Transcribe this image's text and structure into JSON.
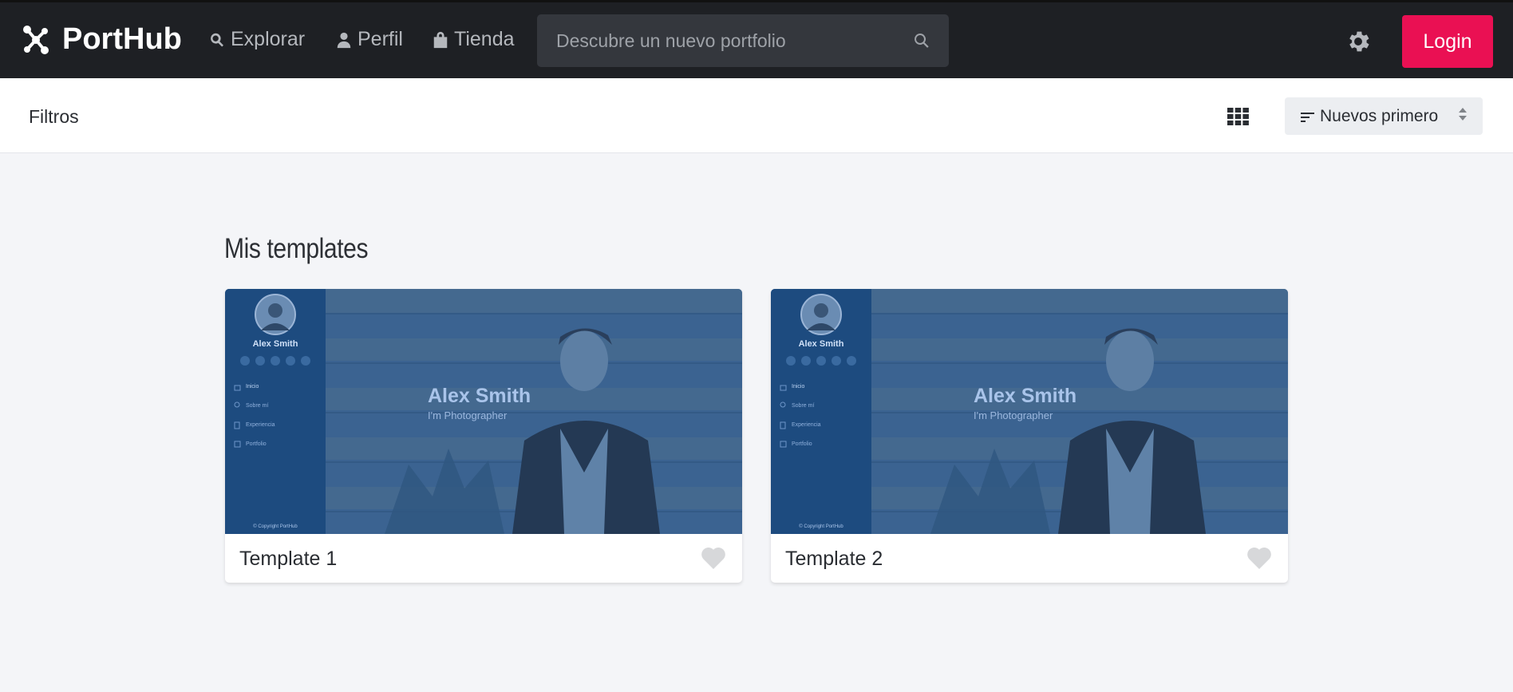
{
  "navbar": {
    "brand": "PortHub",
    "links": [
      {
        "label": "Explorar",
        "icon": "search-icon"
      },
      {
        "label": "Perfil",
        "icon": "user-icon"
      },
      {
        "label": "Tienda",
        "icon": "shopping-bag-icon"
      }
    ],
    "search": {
      "placeholder": "Descubre un nuevo portfolio",
      "value": ""
    },
    "settings_icon": "gear-icon",
    "login_label": "Login",
    "colors": {
      "background": "#1e2024",
      "login": "#ea1053"
    }
  },
  "filterbar": {
    "filters_label": "Filtros",
    "view_icon": "grid-view-icon",
    "sort_label": "Nuevos primero"
  },
  "main": {
    "section_title": "Mis templates",
    "cards": [
      {
        "title": "Template 1",
        "favorited": false,
        "preview": {
          "sidebar_name": "Alex Smith",
          "hero_name": "Alex Smith",
          "hero_subtitle": "I'm Photographer",
          "menu": [
            "Inicio",
            "Sobre mí",
            "Experiencia",
            "Portfolio"
          ],
          "copyright": "© Copyright PortHub"
        }
      },
      {
        "title": "Template 2",
        "favorited": false,
        "preview": {
          "sidebar_name": "Alex Smith",
          "hero_name": "Alex Smith",
          "hero_subtitle": "I'm Photographer",
          "menu": [
            "Inicio",
            "Sobre mí",
            "Experiencia",
            "Portfolio"
          ],
          "copyright": "© Copyright PortHub"
        }
      }
    ]
  }
}
